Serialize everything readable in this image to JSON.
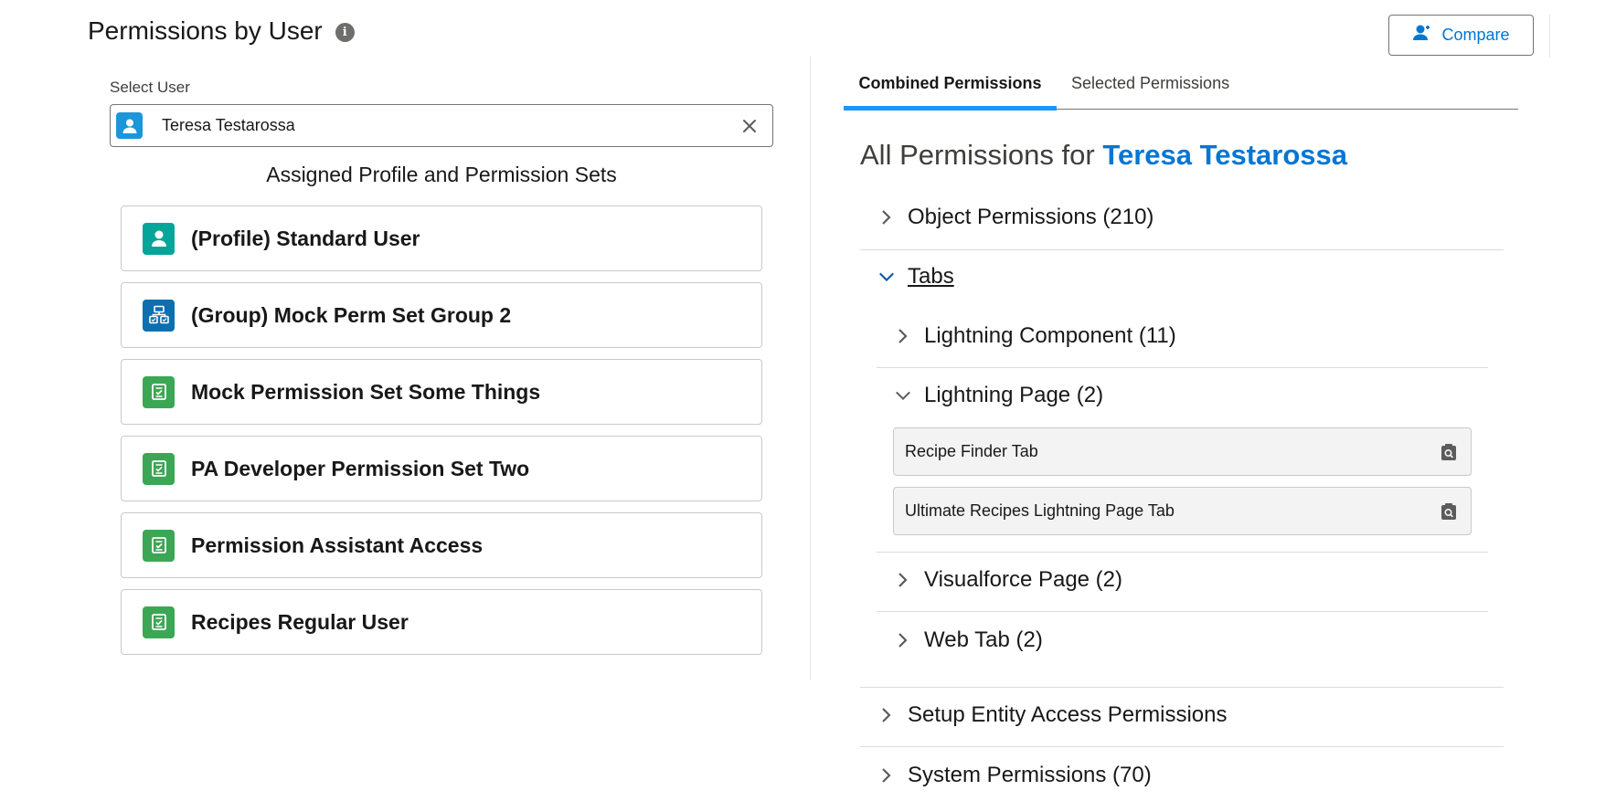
{
  "header": {
    "title": "Permissions by User",
    "compare_label": "Compare"
  },
  "left": {
    "select_label": "Select User",
    "selected_user": "Teresa Testarossa",
    "assigned_heading": "Assigned Profile and Permission Sets",
    "assignments": [
      {
        "label": "(Profile) Standard User",
        "icon": "profile-icon"
      },
      {
        "label": "(Group) Mock Perm Set Group 2",
        "icon": "permission-set-group-icon"
      },
      {
        "label": "Mock Permission Set Some Things",
        "icon": "permission-set-icon"
      },
      {
        "label": "PA Developer Permission Set Two",
        "icon": "permission-set-icon"
      },
      {
        "label": "Permission Assistant Access",
        "icon": "permission-set-icon"
      },
      {
        "label": "Recipes Regular User",
        "icon": "permission-set-icon"
      }
    ]
  },
  "right": {
    "tabs": [
      {
        "label": "Combined Permissions",
        "active": true
      },
      {
        "label": "Selected Permissions",
        "active": false
      }
    ],
    "all_perms_prefix": "All Permissions for",
    "all_perms_user": "Teresa Testarossa",
    "sections": {
      "object": "Object Permissions (210)",
      "tabs": "Tabs",
      "lightning_component": "Lightning Component (11)",
      "lightning_page": "Lightning Page (2)",
      "lightning_page_items": [
        "Recipe Finder Tab",
        "Ultimate Recipes Lightning Page Tab"
      ],
      "visualforce_page": "Visualforce Page (2)",
      "web_tab": "Web Tab (2)",
      "setup_entity": "Setup Entity Access Permissions",
      "system": "System Permissions (70)"
    }
  },
  "colors": {
    "brand_blue": "#0176d3",
    "tab_active": "#1b96ff",
    "profile": "#06a59a",
    "group": "#0b6fb0",
    "permission_set": "#3ba755"
  }
}
